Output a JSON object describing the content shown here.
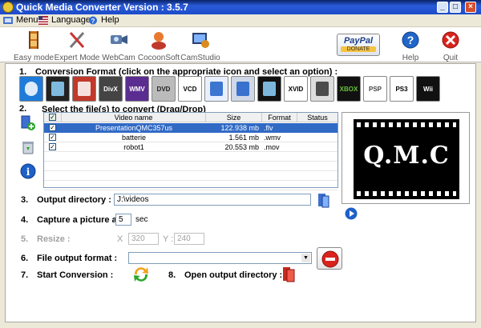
{
  "window": {
    "title": "Quick Media Converter   Version : 3.5.7"
  },
  "menu": {
    "items": [
      "Menu",
      "Languages",
      "Help"
    ]
  },
  "toolbar": {
    "buttons": [
      {
        "label": "Easy mode"
      },
      {
        "label": "Expert Mode"
      },
      {
        "label": "WebCam"
      },
      {
        "label": "CocoonSoft"
      },
      {
        "label": "CamStudio"
      },
      {
        "label": "Help"
      },
      {
        "label": "Quit"
      }
    ],
    "paypal": {
      "line1": "PayPal",
      "line2": "DONATE"
    }
  },
  "step1": {
    "num": "1.",
    "label": "Conversion Format (click on the appropriate icon and select an option) :"
  },
  "formats": [
    "quicktime",
    "ipod",
    "flash",
    "divx",
    "wmv",
    "dvd",
    "vcd",
    "music",
    "mobile",
    "iphone",
    "xvid",
    "audio",
    "xbox",
    "psp",
    "ps3",
    "wii"
  ],
  "format_text": {
    "vcd": "VCD",
    "xvid": "XVID",
    "psp": "PSP",
    "ps3": "PS3",
    "wii": "Wii",
    "wmv": "WMV",
    "divx": "DivX",
    "xbox": "XBOX",
    "dvd": "DVD"
  },
  "step2": {
    "num": "2.",
    "label": "Select the file(s) to convert (Drag/Drop)"
  },
  "table": {
    "columns": [
      "Video name",
      "Size",
      "Format",
      "Status"
    ],
    "rows": [
      {
        "name": "PresentationQMC357us",
        "size": "122.938 mb",
        "format": ".flv",
        "status": "",
        "checked": true,
        "selected": true
      },
      {
        "name": "batterie",
        "size": "1.561 mb",
        "format": ".wmv",
        "status": "",
        "checked": true,
        "selected": false
      },
      {
        "name": "robot1",
        "size": "20.553 mb",
        "format": ".mov",
        "status": "",
        "checked": true,
        "selected": false
      }
    ]
  },
  "preview": {
    "text": "Q.M.C"
  },
  "step3": {
    "num": "3.",
    "label": "Output directory :",
    "value": "J:\\videos"
  },
  "step4": {
    "num": "4.",
    "label": "Capture a picture at :",
    "value": "5",
    "unit": "sec"
  },
  "step5": {
    "num": "5.",
    "label": "Resize :",
    "x_label": "X",
    "x_value": "320",
    "y_label": "Y :",
    "y_value": "240"
  },
  "step6": {
    "num": "6.",
    "label": "File output format :",
    "value": ""
  },
  "step7": {
    "num": "7.",
    "label": "Start Conversion :"
  },
  "step8": {
    "num": "8.",
    "label": "Open output directory :"
  }
}
